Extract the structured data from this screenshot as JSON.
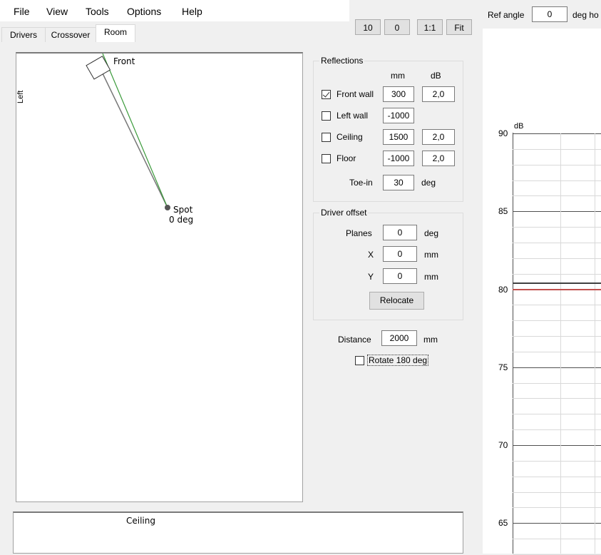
{
  "menu": {
    "file": "File",
    "view": "View",
    "tools": "Tools",
    "options": "Options",
    "help": "Help"
  },
  "tabs": {
    "drivers": "Drivers",
    "crossover": "Crossover",
    "room": "Room"
  },
  "toolbar": {
    "btn10": "10",
    "btn0": "0",
    "btn11": "1:1",
    "fit": "Fit"
  },
  "ref": {
    "label": "Ref angle",
    "value": "0",
    "unit": "deg ho"
  },
  "room_view": {
    "front": "Front",
    "left": "Left",
    "spot": "Spot",
    "spot_angle": "0 deg",
    "ceiling": "Ceiling"
  },
  "reflections": {
    "title": "Reflections",
    "col_mm": "mm",
    "col_db": "dB",
    "rows": [
      {
        "label": "Front wall",
        "checked": true,
        "mm": "300",
        "db": "2,0"
      },
      {
        "label": "Left wall",
        "checked": false,
        "mm": "-1000",
        "db": ""
      },
      {
        "label": "Ceiling",
        "checked": false,
        "mm": "1500",
        "db": "2,0"
      },
      {
        "label": "Floor",
        "checked": false,
        "mm": "-1000",
        "db": "2,0"
      }
    ],
    "toein_label": "Toe-in",
    "toein_value": "30",
    "toein_unit": "deg"
  },
  "driver_offset": {
    "title": "Driver offset",
    "planes_label": "Planes",
    "planes_value": "0",
    "planes_unit": "deg",
    "x_label": "X",
    "x_value": "0",
    "x_unit": "mm",
    "y_label": "Y",
    "y_value": "0",
    "y_unit": "mm",
    "relocate": "Relocate"
  },
  "distance": {
    "label": "Distance",
    "value": "2000",
    "unit": "mm"
  },
  "rotate": {
    "label": "Rotate 180 deg",
    "checked": false
  },
  "chart_data": {
    "type": "line",
    "ylabel": "dB",
    "yticks": [
      "90",
      "85",
      "80",
      "75",
      "70",
      "65"
    ],
    "ylim": [
      63,
      90
    ],
    "series": [
      {
        "color": "#c0504d",
        "values": [
          80
        ]
      },
      {
        "color": "#404040",
        "values": [
          80.4
        ]
      }
    ]
  }
}
